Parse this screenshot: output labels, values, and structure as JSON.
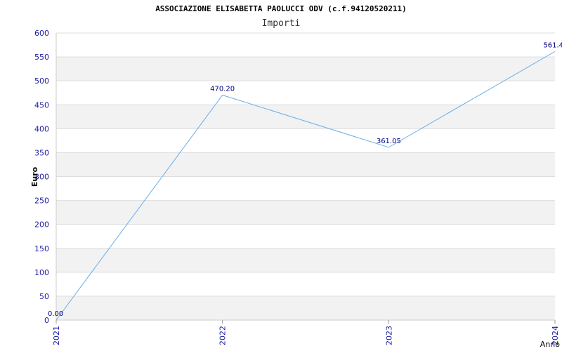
{
  "chart_data": {
    "type": "line",
    "title": "ASSOCIAZIONE ELISABETTA PAOLUCCI ODV (c.f.94120520211)",
    "subtitle": "Importi",
    "xlabel": "Anno",
    "ylabel": "Euro",
    "categories": [
      "2021",
      "2022",
      "2023",
      "2024"
    ],
    "values": [
      0,
      470.2,
      361.05,
      561.4
    ],
    "data_labels": [
      "0.00",
      "470.20",
      "361.05",
      "561.4"
    ],
    "ylim": [
      0,
      600
    ],
    "yticks": [
      0,
      50,
      100,
      150,
      200,
      250,
      300,
      350,
      400,
      450,
      500,
      550,
      600
    ],
    "grid": true,
    "line_color": "#6aaee8",
    "band_color": "#f2f2f2",
    "tick_color": "#1a1aa6"
  }
}
